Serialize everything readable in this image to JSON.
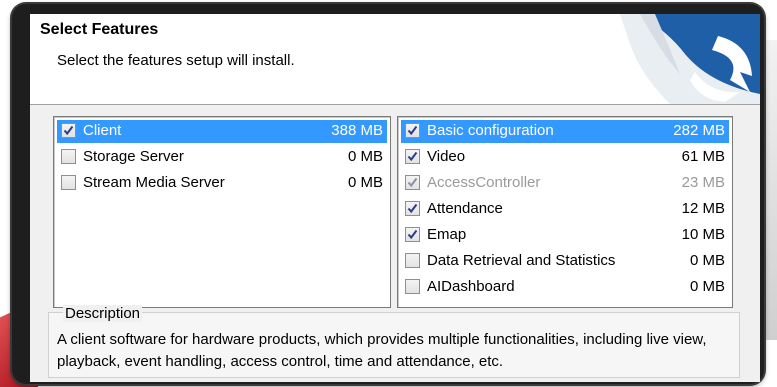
{
  "header": {
    "title": "Select Features",
    "subtitle": "Select the features setup will install."
  },
  "colors": {
    "selection": "#3399ff",
    "logo_blue": "#1f5fa8",
    "frame": "#1e1e1e"
  },
  "left_list": {
    "items": [
      {
        "label": "Client",
        "size": "388 MB",
        "checked": true,
        "selected": true,
        "disabled": false
      },
      {
        "label": "Storage Server",
        "size": "0 MB",
        "checked": false,
        "selected": false,
        "disabled": false
      },
      {
        "label": "Stream Media Server",
        "size": "0 MB",
        "checked": false,
        "selected": false,
        "disabled": false
      }
    ]
  },
  "right_list": {
    "items": [
      {
        "label": "Basic configuration",
        "size": "282 MB",
        "checked": true,
        "selected": true,
        "disabled": false
      },
      {
        "label": "Video",
        "size": "61 MB",
        "checked": true,
        "selected": false,
        "disabled": false
      },
      {
        "label": "AccessController",
        "size": "23 MB",
        "checked": true,
        "selected": false,
        "disabled": true
      },
      {
        "label": "Attendance",
        "size": "12 MB",
        "checked": true,
        "selected": false,
        "disabled": false
      },
      {
        "label": "Emap",
        "size": "10 MB",
        "checked": true,
        "selected": false,
        "disabled": false
      },
      {
        "label": "Data Retrieval and Statistics",
        "size": "0 MB",
        "checked": false,
        "selected": false,
        "disabled": false
      },
      {
        "label": "AIDashboard",
        "size": "0 MB",
        "checked": false,
        "selected": false,
        "disabled": false
      }
    ]
  },
  "description": {
    "legend": "Description",
    "text": "A client software for hardware products, which provides multiple functionalities, including live view, playback, event handling, access control, time and attendance, etc."
  }
}
